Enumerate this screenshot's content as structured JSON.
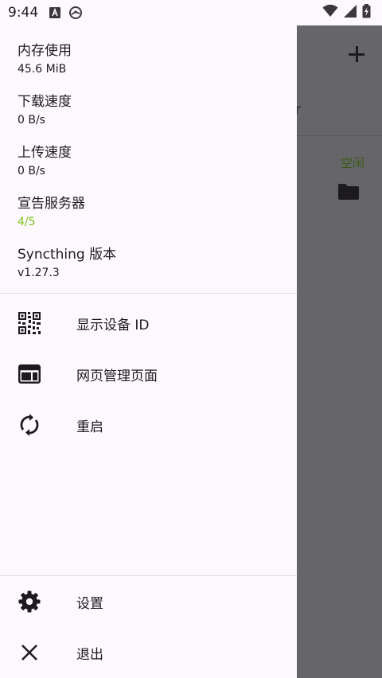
{
  "status_bar": {
    "time": "9:44",
    "icons": [
      "a-icon",
      "sync-status-icon",
      "wifi-icon",
      "signal-icon",
      "battery-icon"
    ]
  },
  "drawer": {
    "stats": [
      {
        "label": "内存使用",
        "value": "45.6 MiB"
      },
      {
        "label": "下载速度",
        "value": "0 B/s"
      },
      {
        "label": "上传速度",
        "value": "0 B/s"
      },
      {
        "label": "宣告服务器",
        "value": "4/5"
      },
      {
        "label": "Syncthing 版本",
        "value": "v1.27.3"
      }
    ],
    "menu": [
      {
        "label": "显示设备 ID",
        "icon": "qr-code-icon"
      },
      {
        "label": "网页管理页面",
        "icon": "web-page-icon"
      },
      {
        "label": "重启",
        "icon": "restart-icon"
      }
    ],
    "bottom_menu": [
      {
        "label": "设置",
        "icon": "gear-icon"
      },
      {
        "label": "退出",
        "icon": "close-icon"
      }
    ]
  },
  "background_app": {
    "tab_fragment": "r",
    "folder_status": "空闲"
  },
  "colors": {
    "drawer_bg": "#fdf8fc",
    "scrim": "#66656a",
    "accent_green": "#7cc316",
    "status_idle": "#3b5b17"
  }
}
